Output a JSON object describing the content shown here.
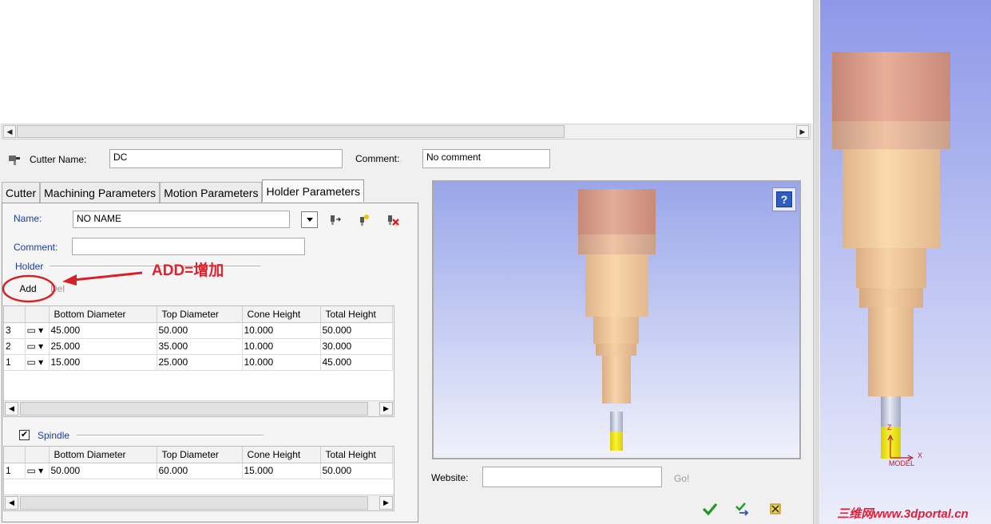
{
  "cutter": {
    "name_label": "Cutter Name:",
    "name_value": "DC",
    "comment_label": "Comment:",
    "comment_value": "No comment"
  },
  "tabs": [
    {
      "label": "Cutter"
    },
    {
      "label": "Machining Parameters"
    },
    {
      "label": "Motion Parameters"
    },
    {
      "label": "Holder Parameters"
    }
  ],
  "holder_form": {
    "name_label": "Name:",
    "name_value": "NO NAME",
    "comment_label": "Comment:",
    "comment_value": "",
    "holder_section": "Holder",
    "add_label": "Add",
    "del_label": "Del"
  },
  "annotation": {
    "text": "ADD=增加"
  },
  "holder_table": {
    "columns": [
      "",
      "",
      "Bottom Diameter",
      "Top Diameter",
      "Cone Height",
      "Total Height"
    ],
    "rows": [
      {
        "num": "3",
        "bottom": "45.000",
        "top": "50.000",
        "cone": "10.000",
        "total": "50.000"
      },
      {
        "num": "2",
        "bottom": "25.000",
        "top": "35.000",
        "cone": "10.000",
        "total": "30.000"
      },
      {
        "num": "1",
        "bottom": "15.000",
        "top": "25.000",
        "cone": "10.000",
        "total": "45.000"
      }
    ]
  },
  "spindle": {
    "label": "Spindle",
    "checked": true,
    "columns": [
      "",
      "",
      "Bottom Diameter",
      "Top Diameter",
      "Cone Height",
      "Total Height"
    ],
    "rows": [
      {
        "num": "1",
        "bottom": "50.000",
        "top": "60.000",
        "cone": "15.000",
        "total": "50.000"
      }
    ]
  },
  "website": {
    "label": "Website:",
    "value": "",
    "go_label": "Go!"
  },
  "viewer": {
    "axis_z": "Z",
    "axis_x": "X",
    "model_label": "MODEL",
    "help_icon": "question-icon"
  },
  "watermark": "三维网www.3dportal.cn",
  "colors": {
    "holder_top": "#d9a08e",
    "holder_body": "#f6ca9a",
    "shank": "#cfd4e2",
    "flute": "#f2ea17",
    "annotation": "#e0202c",
    "label_blue": "#1b3e9a"
  }
}
